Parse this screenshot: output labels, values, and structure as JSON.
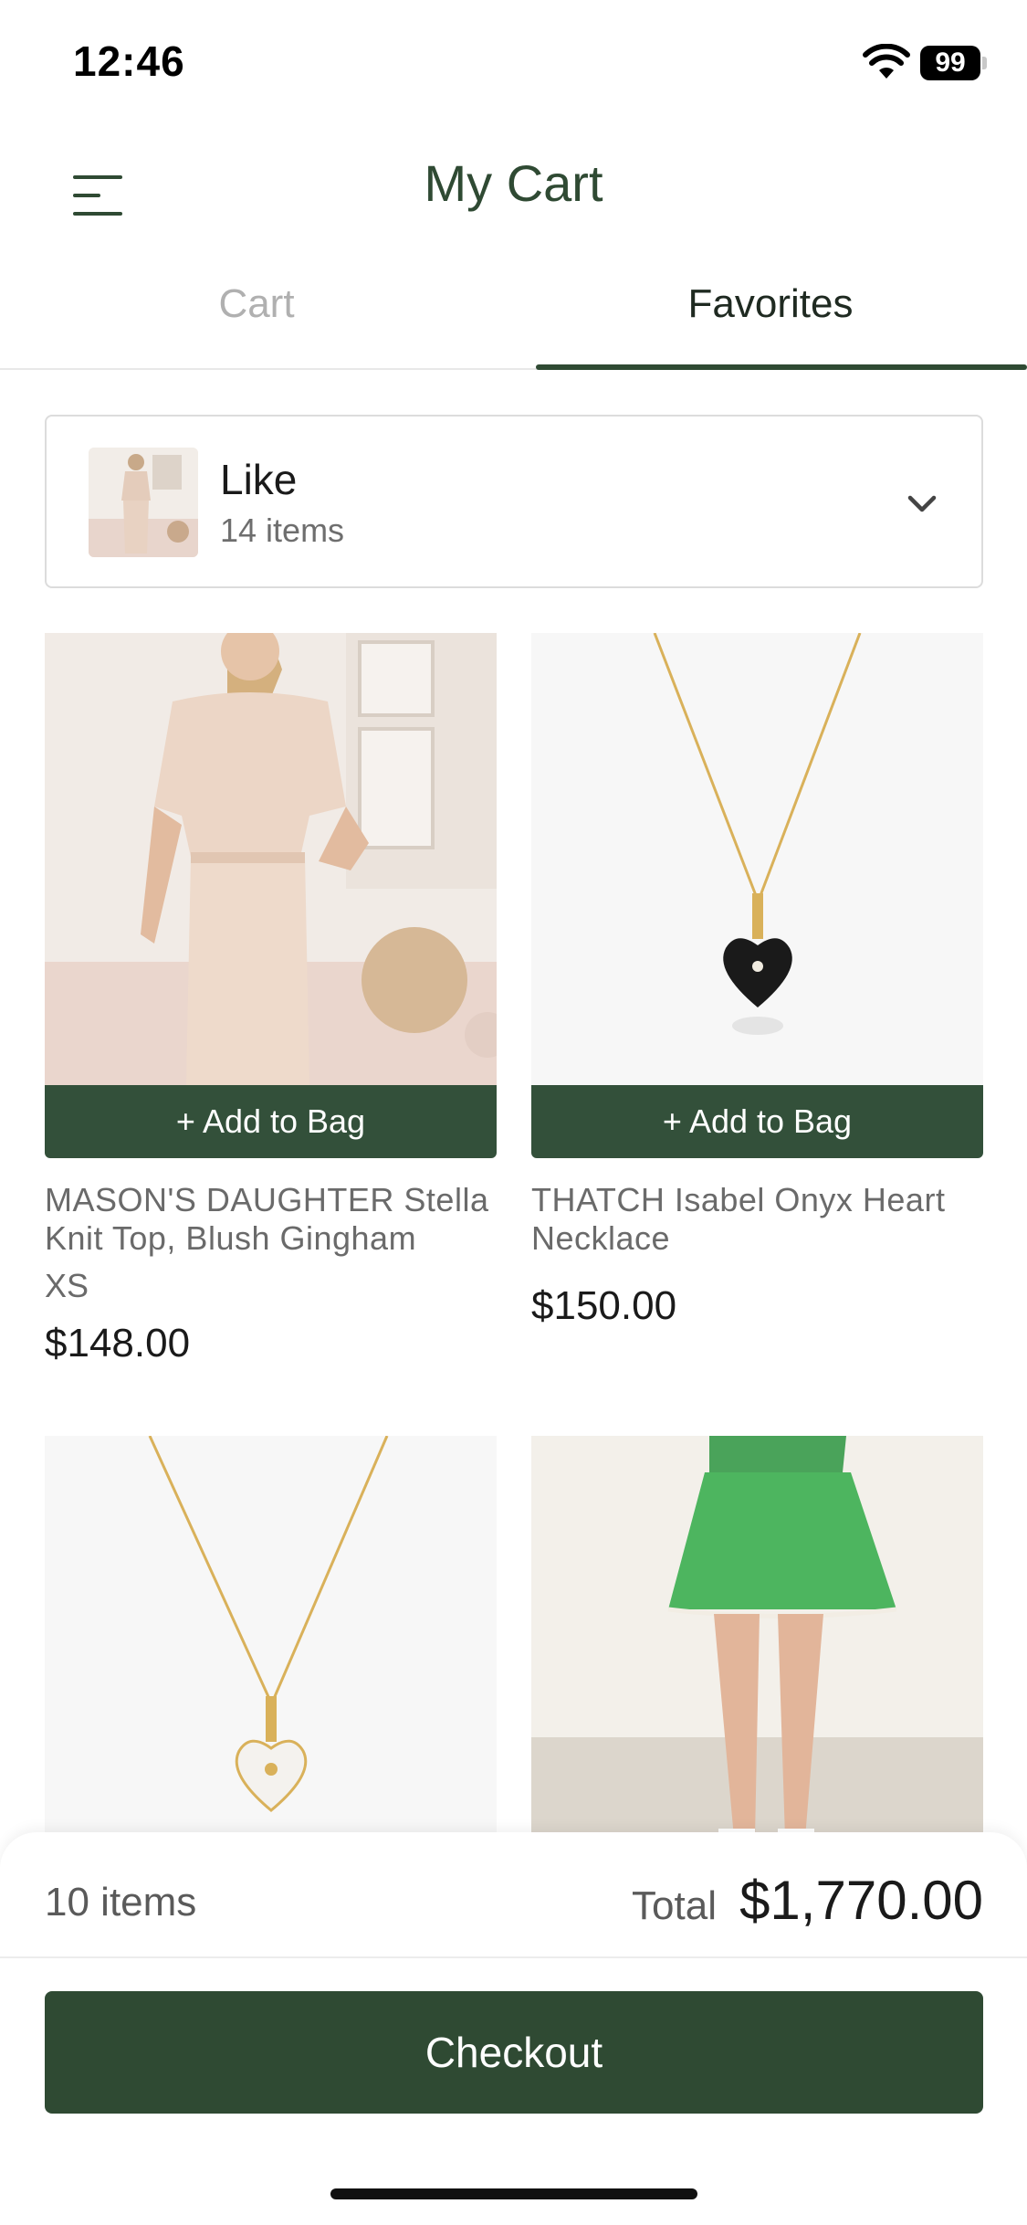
{
  "status_bar": {
    "time": "12:46",
    "battery": "99"
  },
  "header": {
    "title": "My Cart"
  },
  "tabs": [
    {
      "label": "Cart",
      "active": false
    },
    {
      "label": "Favorites",
      "active": true
    }
  ],
  "list_selector": {
    "title": "Like",
    "count": "14 items"
  },
  "products": [
    {
      "name": "MASON'S DAUGHTER Stella Knit Top, Blush Gingham",
      "size": "XS",
      "price": "$148.00",
      "button": "+ Add to Bag"
    },
    {
      "name": "THATCH Isabel Onyx Heart Necklace",
      "size": "",
      "price": "$150.00",
      "button": "+ Add to Bag"
    },
    {
      "name": "",
      "size": "",
      "price": "",
      "button": ""
    },
    {
      "name": "",
      "size": "",
      "price": "",
      "button": ""
    }
  ],
  "summary": {
    "count": "10 items",
    "total_label": "Total",
    "total": "$1,770.00",
    "checkout_label": "Checkout"
  },
  "colors": {
    "brand_green": "#2f4a33",
    "button_green": "#33503a",
    "inactive_tab": "#b0b0b0"
  },
  "icons": [
    "wifi-icon",
    "battery-icon",
    "menu-icon",
    "chevron-down-icon"
  ]
}
